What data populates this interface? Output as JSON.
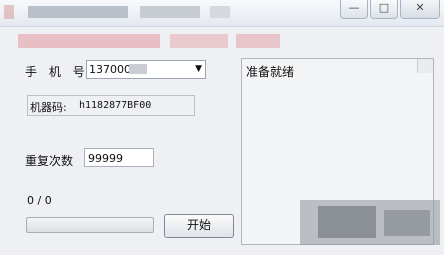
{
  "window": {
    "minimize_label": "—",
    "maximize_label": "□",
    "close_label": "✕"
  },
  "form": {
    "phone_label": "手 机 号",
    "phone_value": "1370000",
    "machine_code_label": "机器码:",
    "machine_code_value": "h1182877BF00",
    "repeat_label": "重复次数",
    "repeat_value": "99999",
    "progress_text": "0 / 0",
    "progress_value": 0,
    "start_label": "开始"
  },
  "log": {
    "status_text": "准备就绪"
  },
  "icons": {
    "combo_arrow": "▼"
  }
}
